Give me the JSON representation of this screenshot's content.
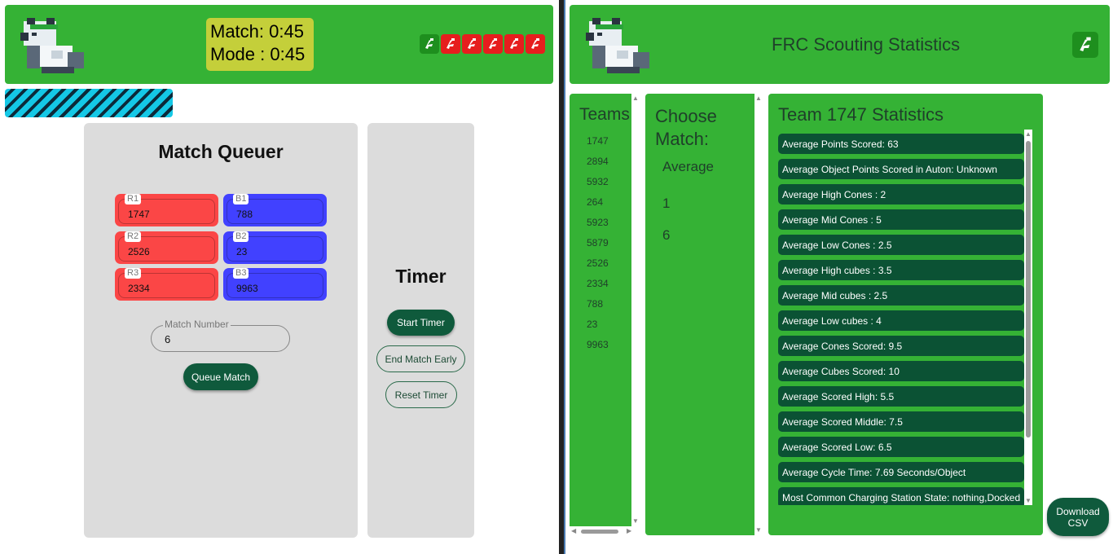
{
  "left": {
    "timer": {
      "match_line": "Match: 0:45",
      "mode_line": "Mode : 0:45"
    },
    "robots": [
      {
        "color": "#1e8f1e",
        "icon": "robot-icon"
      },
      {
        "color": "#e61e1e",
        "icon": "robot-icon"
      },
      {
        "color": "#e61e1e",
        "icon": "robot-icon"
      },
      {
        "color": "#e61e1e",
        "icon": "robot-icon"
      },
      {
        "color": "#e61e1e",
        "icon": "robot-icon"
      },
      {
        "color": "#e61e1e",
        "icon": "robot-icon"
      }
    ],
    "queuer": {
      "title": "Match Queuer",
      "red": [
        {
          "label": "R1",
          "value": "1747"
        },
        {
          "label": "R2",
          "value": "2526"
        },
        {
          "label": "R3",
          "value": "2334"
        }
      ],
      "blue": [
        {
          "label": "B1",
          "value": "788"
        },
        {
          "label": "B2",
          "value": "23"
        },
        {
          "label": "B3",
          "value": "9963"
        }
      ],
      "match_number_label": "Match Number",
      "match_number_value": "6",
      "queue_button": "Queue Match"
    },
    "timer_card": {
      "title": "Timer",
      "start": "Start Timer",
      "end": "End Match Early",
      "reset": "Reset Timer"
    }
  },
  "right": {
    "title": "FRC Scouting Statistics",
    "teams_title": "Teams",
    "teams": [
      "1747",
      "2894",
      "5932",
      "264",
      "5923",
      "5879",
      "2526",
      "2334",
      "788",
      "23",
      "9963"
    ],
    "match_title": "Choose Match:",
    "match_options": [
      "Average",
      "1",
      "6"
    ],
    "stats_title": "Team 1747 Statistics",
    "stats": [
      "Average Points Scored: 63",
      "Average Object Points Scored in Auton: Unknown",
      "Average High Cones : 2",
      "Average Mid Cones : 5",
      "Average Low Cones : 2.5",
      "Average High cubes : 3.5",
      "Average Mid cubes : 2.5",
      "Average Low cubes : 4",
      "Average Cones Scored: 9.5",
      "Average Cubes Scored: 10",
      "Average Scored High: 5.5",
      "Average Scored Middle: 7.5",
      "Average Scored Low: 6.5",
      "Average Cycle Time: 7.69 Seconds/Object",
      "Most Common Charging Station State: nothing,Docked"
    ],
    "download_line1": "Download",
    "download_line2": "CSV"
  },
  "colors": {
    "header_green": "#35b235",
    "button_dark_green": "#0f5a3c",
    "red_alliance": "#fb4646",
    "blue_alliance": "#4141ff",
    "timer_yellow": "#c4cf3a",
    "progress_cyan": "#14c8e6"
  }
}
